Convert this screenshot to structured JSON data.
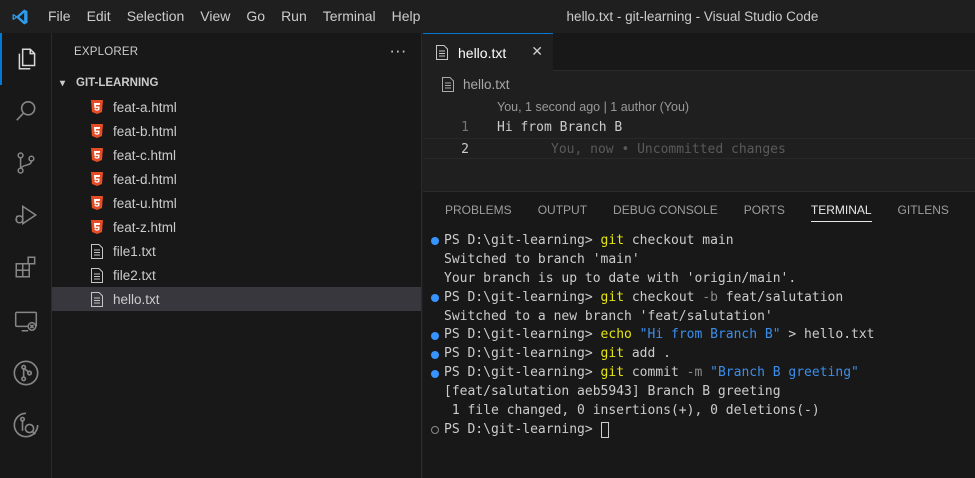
{
  "titlebar": {
    "menu": [
      "File",
      "Edit",
      "Selection",
      "View",
      "Go",
      "Run",
      "Terminal",
      "Help"
    ],
    "title": "hello.txt - git-learning - Visual Studio Code"
  },
  "activitybar": {
    "items": [
      "explorer-icon",
      "search-icon",
      "source-control-icon",
      "run-debug-icon",
      "extensions-icon",
      "remote-explorer-icon",
      "git-graph-icon",
      "gitlens-icon"
    ]
  },
  "sidebar": {
    "title": "EXPLORER",
    "more": "···",
    "folder": "GIT-LEARNING",
    "files": [
      {
        "name": "feat-a.html",
        "type": "html"
      },
      {
        "name": "feat-b.html",
        "type": "html"
      },
      {
        "name": "feat-c.html",
        "type": "html"
      },
      {
        "name": "feat-d.html",
        "type": "html"
      },
      {
        "name": "feat-u.html",
        "type": "html"
      },
      {
        "name": "feat-z.html",
        "type": "html"
      },
      {
        "name": "file1.txt",
        "type": "txt"
      },
      {
        "name": "file2.txt",
        "type": "txt"
      },
      {
        "name": "hello.txt",
        "type": "txt",
        "selected": true
      }
    ]
  },
  "editor": {
    "tab": {
      "label": "hello.txt",
      "close": "✕"
    },
    "breadcrumb": "hello.txt",
    "blame": "You, 1 second ago | 1 author (You)",
    "lines": [
      {
        "number": "1",
        "text": "Hi from Branch B"
      },
      {
        "number": "2",
        "text": "",
        "ghost": "You, now • Uncommitted changes"
      }
    ]
  },
  "panel": {
    "tabs": [
      "PROBLEMS",
      "OUTPUT",
      "DEBUG CONSOLE",
      "PORTS",
      "TERMINAL",
      "GITLENS"
    ],
    "active_tab": "TERMINAL",
    "prompt": "PS D:\\git-learning> ",
    "terminal": {
      "l1_cmd": "git",
      "l1_rest": " checkout main",
      "l2": "Switched to branch 'main'",
      "l3": "Your branch is up to date with 'origin/main'.",
      "l4_cmd": "git",
      "l4_mid": " checkout ",
      "l4_flag": "-b",
      "l4_rest": " feat/salutation",
      "l5": "Switched to a new branch 'feat/salutation'",
      "l6_cmd": "echo",
      "l6_str": " \"Hi from Branch B\"",
      "l6_rest": " > hello.txt",
      "l7_cmd": "git",
      "l7_rest": " add .",
      "l8_cmd": "git",
      "l8_mid": " commit ",
      "l8_flag": "-m",
      "l8_str": " \"Branch B greeting\"",
      "l9": "[feat/salutation aeb5943] Branch B greeting",
      "l10": " 1 file changed, 0 insertions(+), 0 deletions(-)"
    }
  },
  "colors": {
    "accent": "#0078d4",
    "html_icon": "#e44d26",
    "terminal_command": "#e5e510",
    "terminal_string": "#3b8eea",
    "status_dot": "#3794ff"
  }
}
